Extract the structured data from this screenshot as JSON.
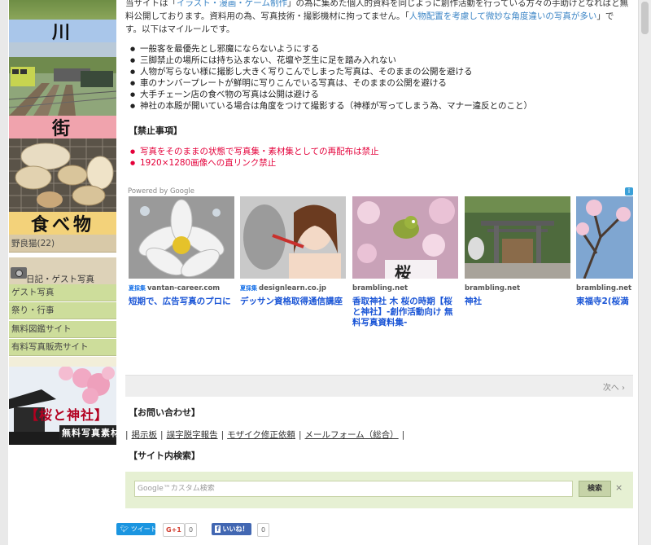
{
  "sidebar": {
    "head_river": "川",
    "head_street": "街",
    "head_food": "食べ物",
    "stray_cat": "野良猫(22)",
    "diary": "日記・ゲスト写真",
    "items": [
      "ゲスト写真",
      "祭り・行事",
      "無料図鑑サイト",
      "有料写真販売サイト"
    ],
    "banner_title": "【桜と神社】",
    "banner_sub": "無料写真素材"
  },
  "intro": {
    "p1": "当サイトは「",
    "p1_link": "イラスト・漫画・ゲーム制作",
    "p2": "」の為に集めた個人的資料を同じように創作活動を行っている方々の手助けとなればと無料公開しております。資料用の為、写真技術・撮影機材に拘ってません。「",
    "p2_link": "人物配置を考慮して微妙な角度違いの写真が多い",
    "p3": "」です。以下はマイルールです。"
  },
  "rules": [
    "一般客を最優先とし邪魔にならないようにする",
    "三脚禁止の場所には持ち込まない、花壇や芝生に足を踏み入れない",
    "人物が写らない様に撮影し大きく写りこんでしまった写真は、そのままの公開を避ける",
    "車のナンバープレートが鮮明に写りこんでいる写真は、そのままの公開を避ける",
    "大手チェーン店の食べ物の写真は公開は避ける",
    "神社の本殿が開いている場合は角度をつけて撮影する（神様が写ってしまう為、マナー違反とのこと）"
  ],
  "banned_title": "【禁止事項】",
  "banned": [
    "写真をそのままの状態で写真集・素材集としての再配布は禁止",
    "1920×1280画像への直リンク禁止"
  ],
  "ads": {
    "powered": "Powered by Google",
    "info": "i",
    "cards": [
      {
        "tag": "夏採集",
        "domain": "vantan-career.com",
        "title": "短期で、広告写真のプロに"
      },
      {
        "tag": "夏採集",
        "domain": "designlearn.co.jp",
        "title": "デッサン資格取得通信講座"
      },
      {
        "tag": "",
        "domain": "brambling.net",
        "title": "香取神社 木 桜の時期【桜と神社】-創作活動向け 無料写真資料集-"
      },
      {
        "tag": "",
        "domain": "brambling.net",
        "title": "神社"
      },
      {
        "tag": "",
        "domain": "brambling.net",
        "title": "東福寺2(桜満"
      }
    ],
    "sakura_label": "桜",
    "next": "次へ ›"
  },
  "contact_title": "【お問い合わせ】",
  "links": [
    "掲示板",
    "誤字脱字報告",
    "モザイク修正依頼",
    "メールフォーム（総合）"
  ],
  "site_search_title": "【サイト内検索】",
  "search": {
    "placeholder": "Google™カスタム検索",
    "button": "検索",
    "clear": "×"
  },
  "social": {
    "tweet": "ツイート",
    "gplus": "G+1",
    "gplus_count": "0",
    "fb": "いいね！",
    "fb_count": "0"
  }
}
